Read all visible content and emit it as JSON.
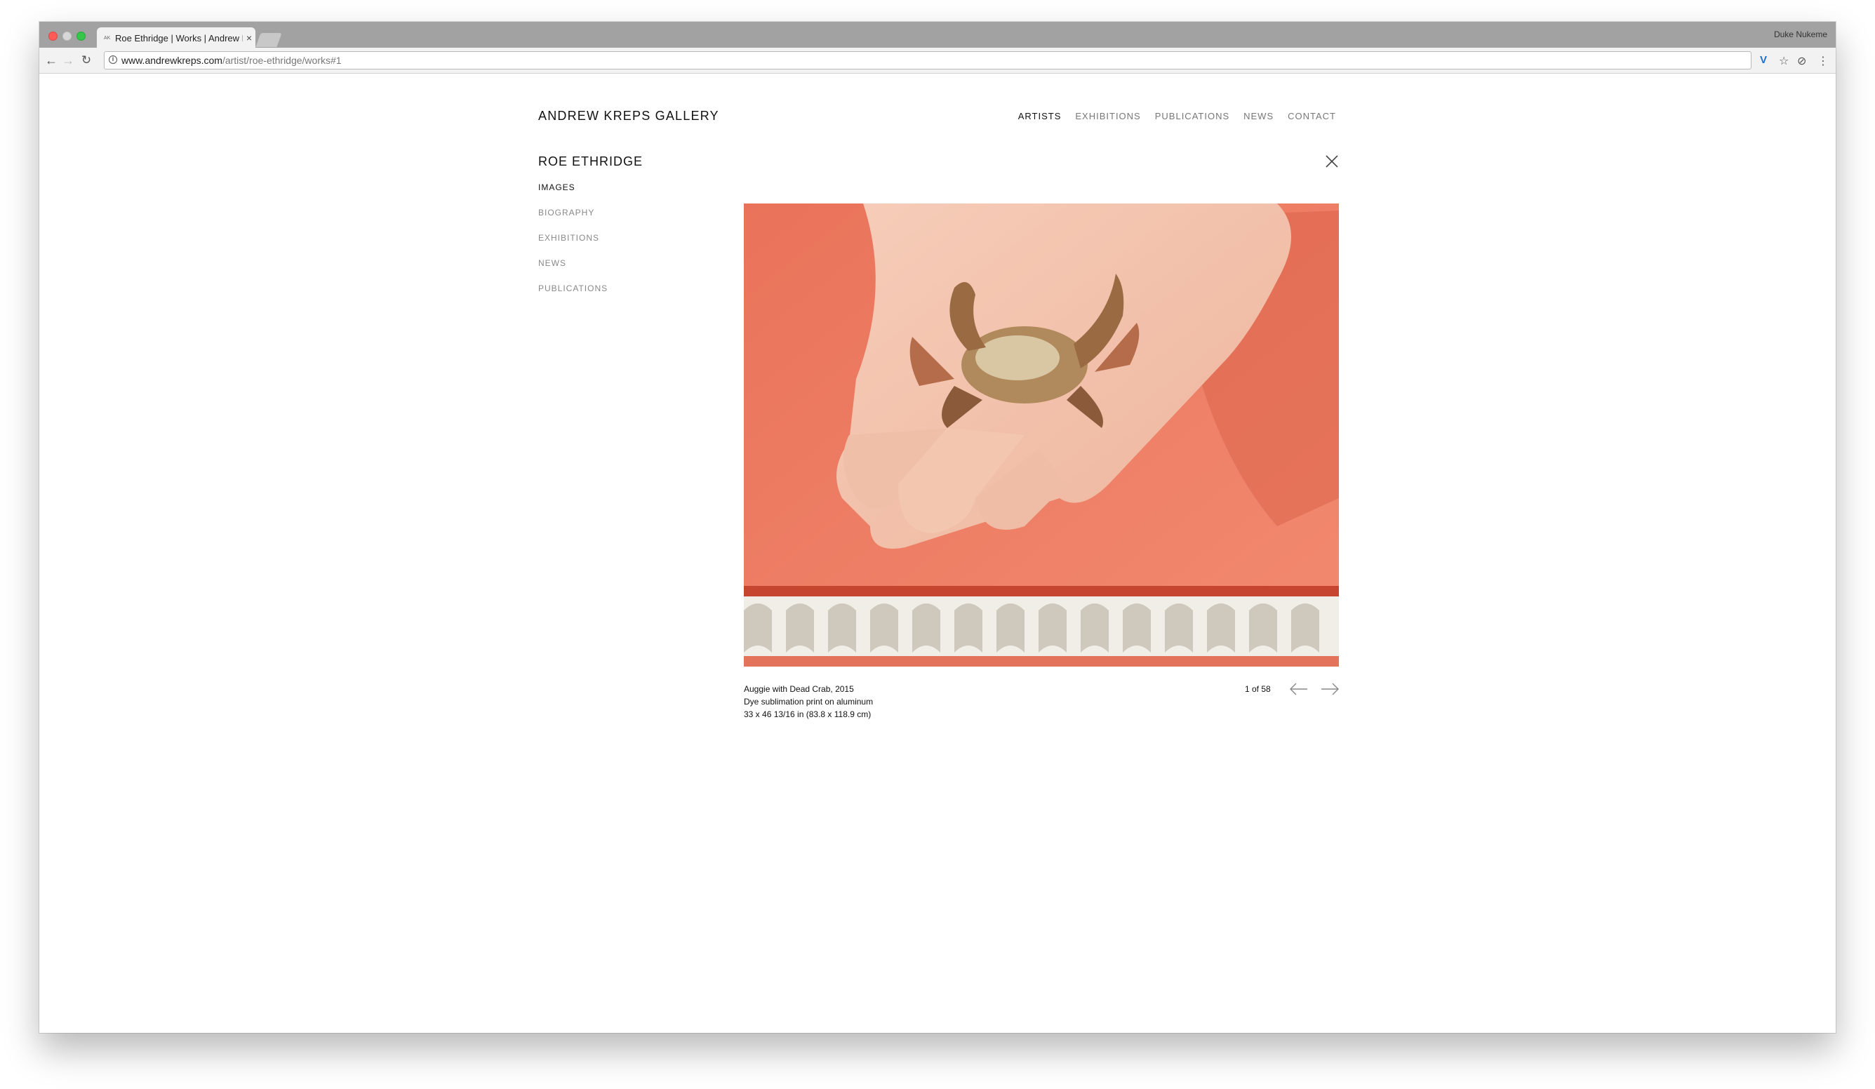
{
  "browser": {
    "tab_title": "Roe Ethridge | Works | Andrew Kreps Gallery",
    "favicon_text": "AK",
    "profile_name": "Duke Nukeme",
    "url_host": "www.andrewkreps.com",
    "url_path": "/artist/roe-ethridge/works#1"
  },
  "site": {
    "brand": "ANDREW KREPS GALLERY",
    "nav": [
      {
        "label": "ARTISTS",
        "active": true
      },
      {
        "label": "EXHIBITIONS",
        "active": false
      },
      {
        "label": "PUBLICATIONS",
        "active": false
      },
      {
        "label": "NEWS",
        "active": false
      },
      {
        "label": "CONTACT",
        "active": false
      }
    ],
    "artist_name": "ROE ETHRIDGE",
    "subnav": [
      {
        "label": "IMAGES",
        "active": true
      },
      {
        "label": "BIOGRAPHY",
        "active": false
      },
      {
        "label": "EXHIBITIONS",
        "active": false
      },
      {
        "label": "NEWS",
        "active": false
      },
      {
        "label": "PUBLICATIONS",
        "active": false
      }
    ]
  },
  "work": {
    "title_line": "Auggie with Dead Crab, 2015",
    "medium": "Dye sublimation print on aluminum",
    "dimensions": "33 x 46 13/16 in (83.8 x 118.9 cm)",
    "counter": "1 of 58"
  },
  "colors": {
    "background_orange": "#ee7a62",
    "rope_white": "#f1eee8"
  }
}
